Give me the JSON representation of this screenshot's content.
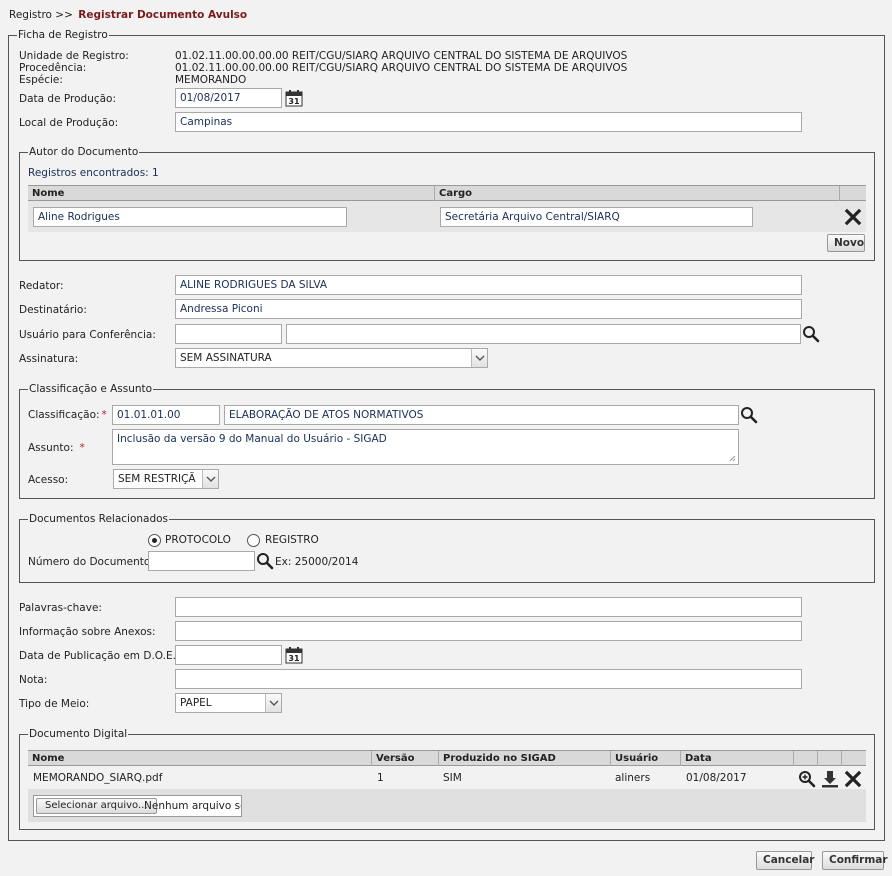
{
  "breadcrumb": {
    "root": "Registro >>",
    "current": "Registrar Documento Avulso"
  },
  "ficha": {
    "legend": "Ficha de Registro",
    "unidade_label": "Unidade de Registro:",
    "unidade_value": "01.02.11.00.00.00.00 REIT/CGU/SIARQ ARQUIVO CENTRAL DO SISTEMA DE ARQUIVOS",
    "procedencia_label": "Procedência:",
    "procedencia_value": "01.02.11.00.00.00.00 REIT/CGU/SIARQ ARQUIVO CENTRAL DO SISTEMA DE ARQUIVOS",
    "especie_label": "Espécie:",
    "especie_value": "MEMORANDO",
    "data_producao_label": "Data de Produção:",
    "data_producao_value": "01/08/2017",
    "local_producao_label": "Local de Produção:",
    "local_producao_value": "Campinas"
  },
  "autor": {
    "legend": "Autor do Documento",
    "registros": "Registros encontrados: 1",
    "col_nome": "Nome",
    "col_cargo": "Cargo",
    "row_nome": "Aline Rodrigues",
    "row_cargo": "Secretária Arquivo Central/SIARQ",
    "novo_label": "Novo"
  },
  "pessoas": {
    "redator_label": "Redator:",
    "redator_value": "ALINE RODRIGUES DA SILVA",
    "destinatario_label": "Destinatário:",
    "destinatario_value": "Andressa Piconi",
    "usuario_conf_label": "Usuário para Conferência:",
    "usuario_conf_code": "",
    "usuario_conf_name": "",
    "assinatura_label": "Assinatura:",
    "assinatura_value": "SEM ASSINATURA"
  },
  "classificacao": {
    "legend": "Classificação e Assunto",
    "class_label": "Classificação:",
    "class_code": "01.01.01.00",
    "class_desc": "ELABORAÇÃO DE ATOS NORMATIVOS",
    "assunto_label": "Assunto:",
    "assunto_value": "Inclusão da versão 9 do Manual do Usuário - SIGAD",
    "acesso_label": "Acesso:",
    "acesso_value": "SEM RESTRIÇÃ"
  },
  "relacionados": {
    "legend": "Documentos Relacionados",
    "opt_protocolo": "PROTOCOLO",
    "opt_registro": "REGISTRO",
    "numero_label": "Número do Documento:",
    "numero_value": "",
    "exemplo": "Ex: 25000/2014"
  },
  "extras": {
    "palavras_label": "Palavras-chave:",
    "palavras_value": "",
    "anexos_label": "Informação sobre Anexos:",
    "anexos_value": "",
    "doe_label": "Data de Publicação em D.O.E.:",
    "doe_value": "",
    "nota_label": "Nota:",
    "nota_value": "",
    "tipo_meio_label": "Tipo de Meio:",
    "tipo_meio_value": "PAPEL"
  },
  "digital": {
    "legend": "Documento Digital",
    "col_nome": "Nome",
    "col_versao": "Versão",
    "col_produzido": "Produzido no SIGAD",
    "col_usuario": "Usuário",
    "col_data": "Data",
    "row": {
      "nome": "MEMORANDO_SIARQ.pdf",
      "versao": "1",
      "produzido": "SIM",
      "usuario": "aliners",
      "data": "01/08/2017"
    },
    "file_button": "Selecionar arquivo...",
    "file_status": "Nenhum arquivo sel"
  },
  "footer": {
    "cancelar": "Cancelar",
    "confirmar": "Confirmar"
  },
  "colors": {
    "accent": "#7a1a1a",
    "link": "#1b2e55",
    "required": "#b22222"
  }
}
